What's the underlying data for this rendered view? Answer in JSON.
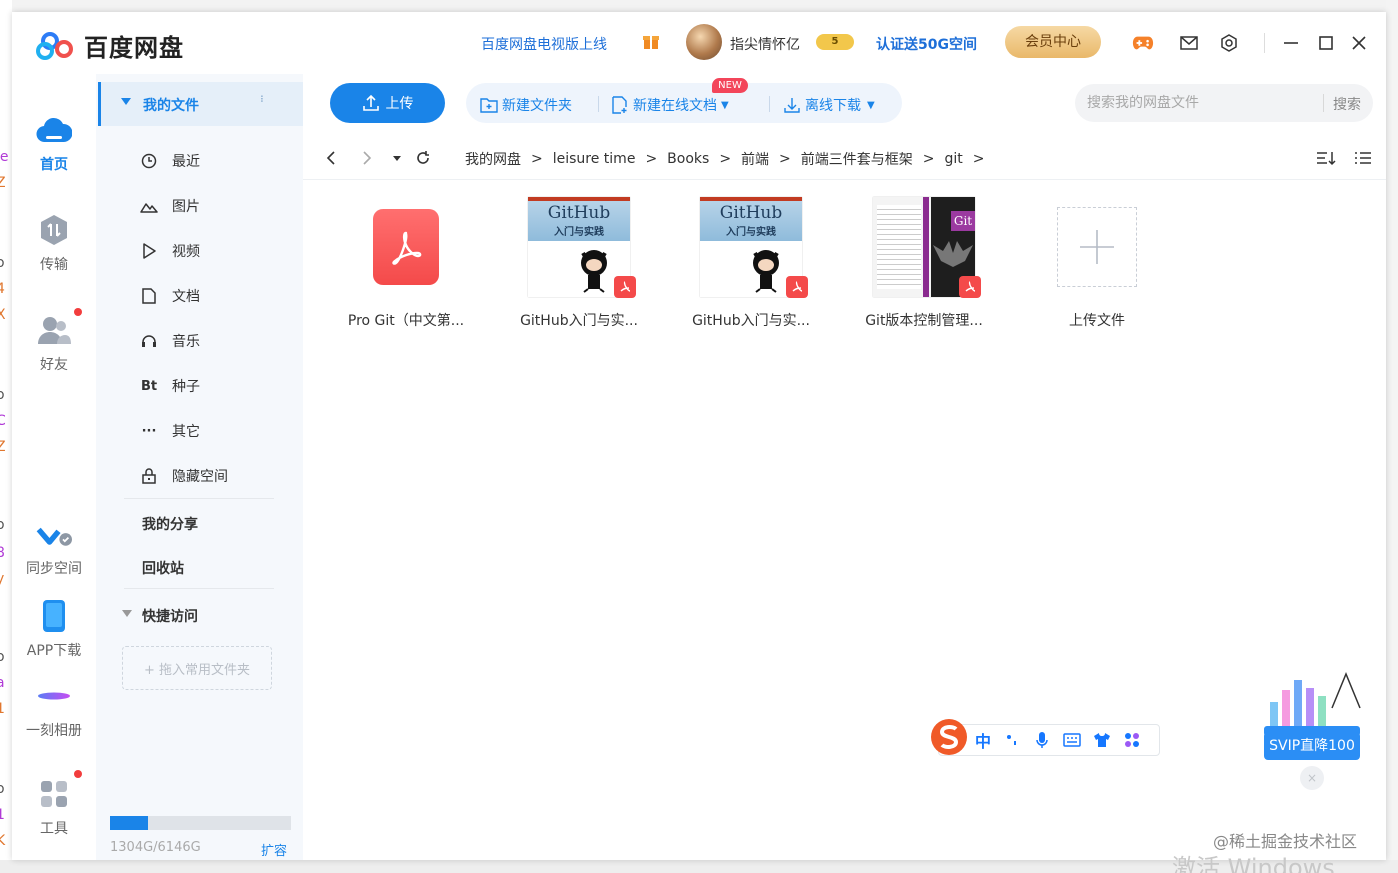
{
  "window": {
    "app_name": "百度网盘",
    "tv_link": "百度网盘电视版上线",
    "username": "指尖情怀亿",
    "vip_level": "5",
    "verify_link": "认证送50G空间",
    "member_center": "会员中心"
  },
  "iconnav": {
    "home": "首页",
    "transfer": "传输",
    "friends": "好友",
    "sync": "同步空间",
    "app": "APP下载",
    "album": "一刻相册",
    "tools": "工具"
  },
  "sidebar": {
    "my_files": "我的文件",
    "items": [
      {
        "label": "最近",
        "icon": "clock-icon"
      },
      {
        "label": "图片",
        "icon": "image-icon"
      },
      {
        "label": "视频",
        "icon": "video-icon"
      },
      {
        "label": "文档",
        "icon": "document-icon"
      },
      {
        "label": "音乐",
        "icon": "headphones-icon"
      },
      {
        "label": "种子",
        "icon": "torrent-icon",
        "glyph": "Bt"
      },
      {
        "label": "其它",
        "icon": "more-icon",
        "glyph": "···"
      },
      {
        "label": "隐藏空间",
        "icon": "lock-icon"
      }
    ],
    "my_share": "我的分享",
    "recycle": "回收站",
    "quick_access": "快捷访问",
    "drop_hint": "+ 拖入常用文件夹",
    "quota": "1304G/6146G",
    "quota_used_fraction": 0.212,
    "expand": "扩容"
  },
  "toolbar": {
    "upload": "上传",
    "new_folder": "新建文件夹",
    "new_online_doc": "新建在线文档",
    "new_badge": "NEW",
    "offline_download": "离线下载",
    "search_placeholder": "搜索我的网盘文件",
    "search_button": "搜索"
  },
  "breadcrumb": [
    "我的网盘",
    "leisure time",
    "Books",
    "前端",
    "前端三件套与框架",
    "git"
  ],
  "files": [
    {
      "name": "Pro Git（中文第...",
      "type": "pdf"
    },
    {
      "name": "GitHub入门与实...",
      "type": "book"
    },
    {
      "name": "GitHub入门与实...",
      "type": "book"
    },
    {
      "name": "Git版本控制管理...",
      "type": "book-dark"
    },
    {
      "name": "上传文件",
      "type": "upload"
    }
  ],
  "book_cover": {
    "title": "GitHub",
    "subtitle": "入门与实践",
    "git_label": "Git"
  },
  "ime": {
    "mode": "中"
  },
  "svip": {
    "label": "SVIP直降100",
    "close": "×"
  },
  "watermark": "@稀土掘金技术社区",
  "background": {
    "left_edge": [
      "le",
      "Z",
      "o",
      "4",
      "X",
      "o",
      "C",
      "Z",
      "o",
      "8",
      "y",
      "o",
      "a",
      "1",
      "o",
      "1",
      "K"
    ],
    "activate_text": "激活 Windows"
  }
}
